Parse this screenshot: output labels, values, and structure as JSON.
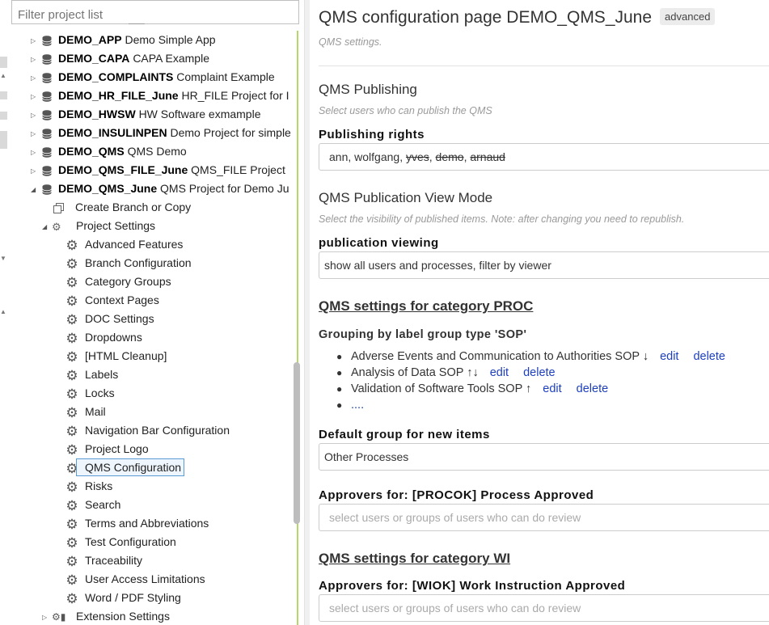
{
  "filter": {
    "placeholder": "Filter project list"
  },
  "projects": [
    {
      "code": "DEMO_APP",
      "desc": "Demo Simple App"
    },
    {
      "code": "DEMO_CAPA",
      "desc": "CAPA Example"
    },
    {
      "code": "DEMO_COMPLAINTS",
      "desc": "Complaint Example"
    },
    {
      "code": "DEMO_HR_FILE_June",
      "desc": "HR_FILE Project for I"
    },
    {
      "code": "DEMO_HWSW",
      "desc": "HW Software exmample"
    },
    {
      "code": "DEMO_INSULINPEN",
      "desc": "Demo Project for simple"
    },
    {
      "code": "DEMO_QMS",
      "desc": "QMS Demo"
    },
    {
      "code": "DEMO_QMS_FILE_June",
      "desc": "QMS_FILE Project"
    },
    {
      "code": "DEMO_QMS_June",
      "desc": "QMS Project for Demo Ju"
    }
  ],
  "tree": {
    "create_branch": "Create Branch or Copy",
    "project_settings": "Project Settings",
    "settings_items": [
      "Advanced Features",
      "Branch Configuration",
      "Category Groups",
      "Context Pages",
      "DOC Settings",
      "Dropdowns",
      "[HTML Cleanup]",
      "Labels",
      "Locks",
      "Mail",
      "Navigation Bar Configuration",
      "Project Logo",
      "QMS Configuration",
      "Risks",
      "Search",
      "Terms and Abbreviations",
      "Test Configuration",
      "Traceability",
      "User Access Limitations",
      "Word / PDF Styling"
    ],
    "selected_item": "QMS Configuration",
    "extension_settings": "Extension Settings"
  },
  "main": {
    "title": "QMS configuration page DEMO_QMS_June",
    "badge": "advanced",
    "subtitle": "QMS settings.",
    "publishing": {
      "heading": "QMS Publishing",
      "hint": "Select users who can publish the QMS",
      "label": "Publishing rights",
      "users": [
        {
          "name": "ann",
          "struck": false
        },
        {
          "name": "wolfgang",
          "struck": false
        },
        {
          "name": "yves",
          "struck": true
        },
        {
          "name": "demo",
          "struck": true
        },
        {
          "name": "arnaud",
          "struck": true
        }
      ]
    },
    "view_mode": {
      "heading": "QMS Publication View Mode",
      "hint": "Select the visibility of published items. Note: after changing you need to republish.",
      "label": "publication viewing",
      "value": "show all users and processes, filter by viewer"
    },
    "proc": {
      "heading": "QMS settings for category PROC",
      "group_label": "Grouping by label group type 'SOP'",
      "items": [
        {
          "text": "Adverse Events and Communication to Authorities SOP",
          "arrows": "↓",
          "edit": "edit",
          "delete": "delete"
        },
        {
          "text": "Analysis of Data SOP",
          "arrows": "↑↓",
          "edit": "edit",
          "delete": "delete"
        },
        {
          "text": "Validation of Software Tools SOP",
          "arrows": "↑",
          "edit": "edit",
          "delete": "delete"
        }
      ],
      "more": "....",
      "default_label": "Default group for new items",
      "default_value": "Other Processes",
      "approvers_label": "Approvers for: [PROCOK] Process Approved",
      "approvers_placeholder": "select users or groups of users who can do review"
    },
    "wi": {
      "heading": "QMS settings for category WI",
      "approvers_label": "Approvers for: [WIOK] Work Instruction Approved",
      "approvers_placeholder": "select users or groups of users who can do review"
    }
  }
}
